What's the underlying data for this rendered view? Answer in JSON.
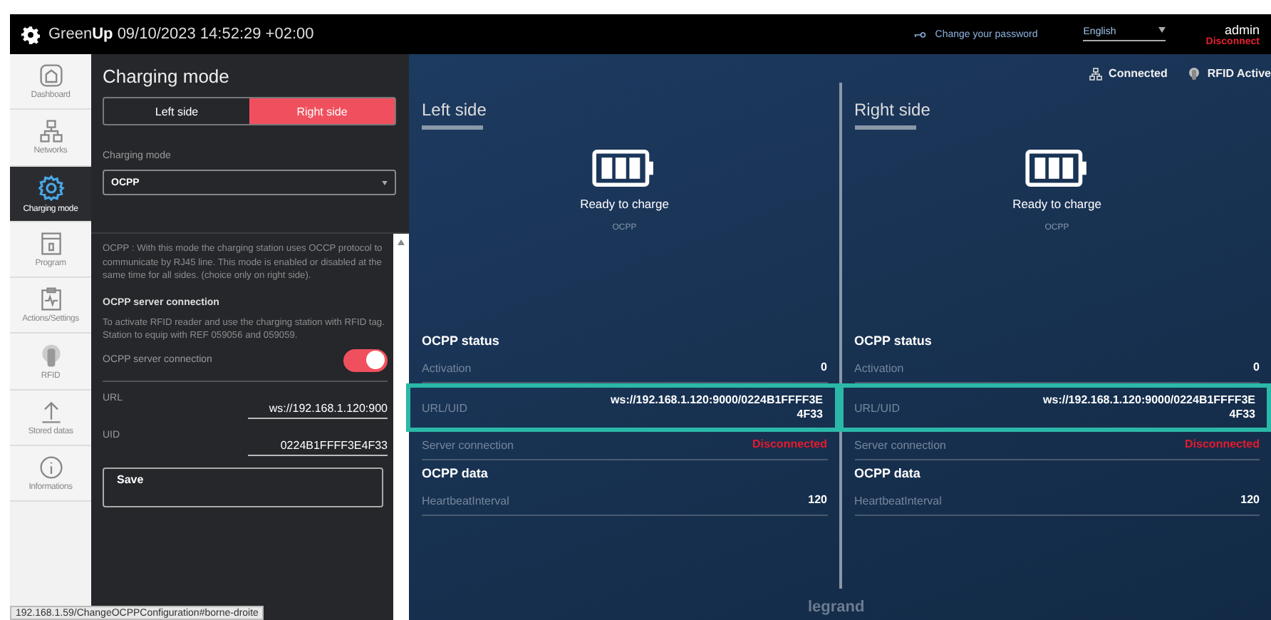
{
  "header": {
    "brand_prefix": "Green",
    "brand_suffix": "Up",
    "datetime": "09/10/2023 14:52:29 +02:00",
    "password_link": "Change your password",
    "language": "English",
    "user": "admin",
    "logout": "Disconnect"
  },
  "sidebar": {
    "items": [
      {
        "label": "Dashboard",
        "selected": false
      },
      {
        "label": "Networks",
        "selected": false
      },
      {
        "label": "Charging mode",
        "selected": true
      },
      {
        "label": "Program",
        "selected": false
      },
      {
        "label": "Actions/Settings",
        "selected": false
      },
      {
        "label": "RFID",
        "selected": false
      },
      {
        "label": "Stored datas",
        "selected": false
      },
      {
        "label": "Informations",
        "selected": false
      }
    ]
  },
  "settings_panel": {
    "title": "Charging mode",
    "side_tabs": [
      {
        "label": "Left side",
        "selected": false
      },
      {
        "label": "Right side",
        "selected": true
      }
    ],
    "mode_label": "Charging mode",
    "mode_value": "OCPP",
    "description": "OCPP : With this mode the charging station uses OCCP protocol to communicate by RJ45 line. This mode is enabled or disabled at the same time for all sides. (choice only on right side).",
    "section_title": "OCPP server connection",
    "section_text": "To activate RFID reader and use the charging station with RFID tag. Station to equip with REF 059056 and 059059.",
    "toggle": {
      "label": "OCPP server connection",
      "on": true
    },
    "fields": [
      {
        "label": "URL",
        "value": "ws://192.168.1.120:900"
      },
      {
        "label": "UID",
        "value": "0224B1FFFF3E4F33"
      }
    ],
    "save": "Save"
  },
  "status": {
    "network": "Connected",
    "rfid": "RFID Active"
  },
  "sides": [
    {
      "title": "Left side",
      "state": "Ready to charge",
      "mode": "OCPP",
      "sections": [
        {
          "title": "OCPP status",
          "rows": [
            {
              "label": "Activation",
              "value": "0",
              "highlighted": false,
              "alert": false
            },
            {
              "label": "URL/UID",
              "value": "ws://192.168.1.120:9000/0224B1FFFF3E4F33",
              "highlighted": true,
              "alert": false
            },
            {
              "label": "Server connection",
              "value": "Disconnected",
              "highlighted": false,
              "alert": true
            }
          ]
        },
        {
          "title": "OCPP data",
          "rows": [
            {
              "label": "HeartbeatInterval",
              "value": "120",
              "highlighted": false,
              "alert": false
            }
          ]
        }
      ]
    },
    {
      "title": "Right side",
      "state": "Ready to charge",
      "mode": "OCPP",
      "sections": [
        {
          "title": "OCPP status",
          "rows": [
            {
              "label": "Activation",
              "value": "0",
              "highlighted": false,
              "alert": false
            },
            {
              "label": "URL/UID",
              "value": "ws://192.168.1.120:9000/0224B1FFFF3E4F33",
              "highlighted": true,
              "alert": false
            },
            {
              "label": "Server connection",
              "value": "Disconnected",
              "highlighted": false,
              "alert": true
            }
          ]
        },
        {
          "title": "OCPP data",
          "rows": [
            {
              "label": "HeartbeatInterval",
              "value": "120",
              "highlighted": false,
              "alert": false
            }
          ]
        }
      ]
    }
  ],
  "footer_logo": "legrand",
  "status_bar": "192.168.1.59/ChangeOCPPConfiguration#borne-droite"
}
